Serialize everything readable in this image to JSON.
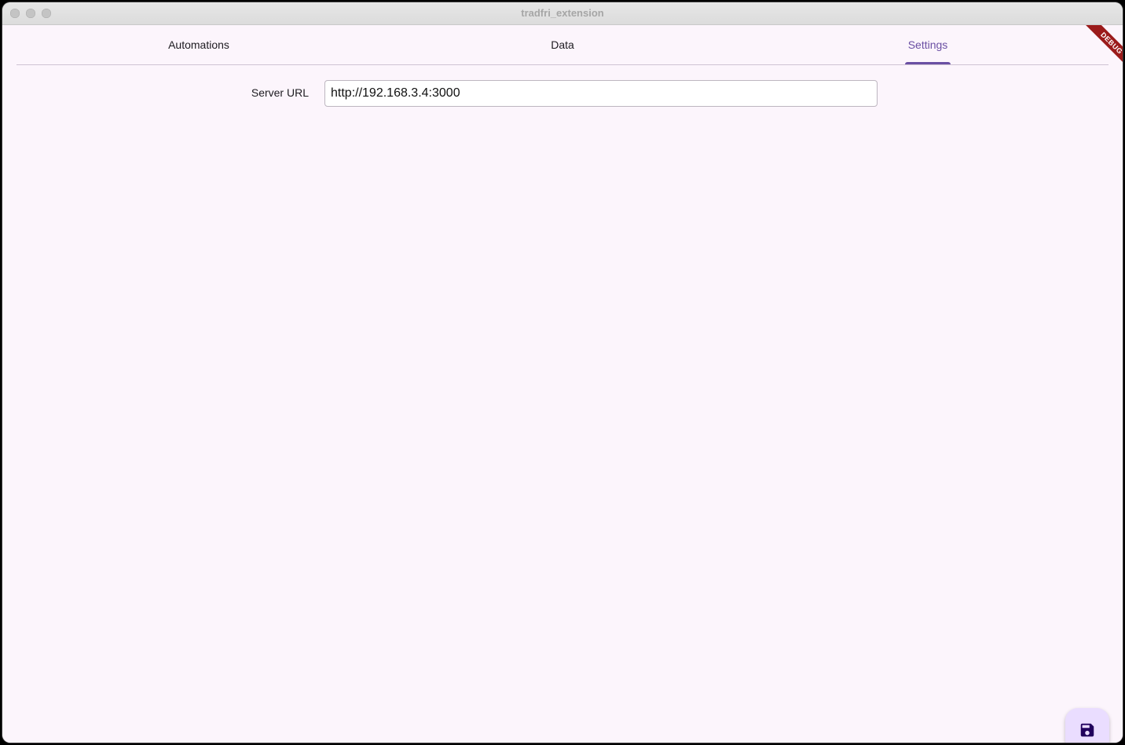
{
  "window": {
    "title": "tradfri_extension"
  },
  "tabs": [
    {
      "label": "Automations"
    },
    {
      "label": "Data"
    },
    {
      "label": "Settings",
      "selected": true
    }
  ],
  "settings": {
    "server_url_label": "Server URL",
    "server_url_value": "http://192.168.3.4:3000"
  },
  "debug_banner": {
    "label": "DEBUG"
  },
  "fab": {
    "icon": "save-icon"
  },
  "colors": {
    "accent": "#6a4fa3",
    "background": "#fcf5fc",
    "fab_background": "#eaddff",
    "debug_ribbon": "#9b1b1b"
  }
}
